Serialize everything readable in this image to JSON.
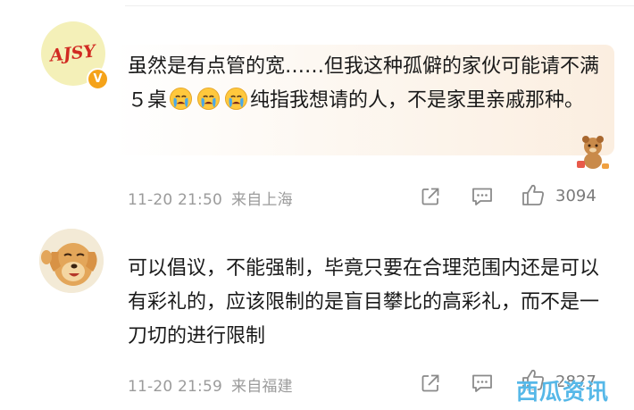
{
  "comments": [
    {
      "avatar_label": "AJSY",
      "verified_mark": "V",
      "text_before": "虽然是有点管的宽……但我这种孤僻的家伙可能请不满５桌",
      "emoji": [
        "crying-face",
        "crying-face",
        "crying-face"
      ],
      "text_after": "纯指我想请的人，不是家里亲戚那种。",
      "date": "11-20 21:50",
      "location": "来自上海",
      "likes": "3094"
    },
    {
      "text": "可以倡议，不能强制，毕竟只要在合理范围内还是可以有彩礼的，应该限制的是盲目攀比的高彩礼，而不是一刀切的进行限制",
      "date": "11-20 21:59",
      "location": "来自福建",
      "likes": "2827"
    }
  ],
  "watermark": "西瓜资讯",
  "colors": {
    "meta_text": "#9b9b9b",
    "verified_badge": "#f5a31a",
    "watermark": "#56b8e8",
    "bubble_highlight": "#fbeee0"
  },
  "icons": [
    "share-icon",
    "comment-icon",
    "like-icon",
    "bear-sticker-icon"
  ]
}
